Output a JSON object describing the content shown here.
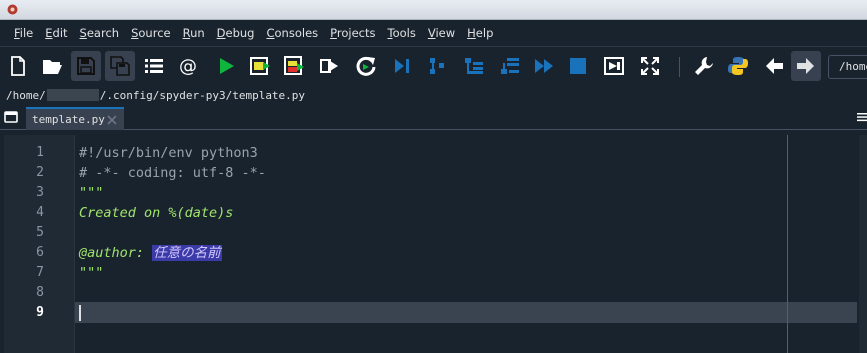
{
  "menu": [
    "File",
    "Edit",
    "Search",
    "Source",
    "Run",
    "Debug",
    "Consoles",
    "Projects",
    "Tools",
    "View",
    "Help"
  ],
  "toolbar": {
    "buttons": [
      "new-file",
      "open-file",
      "save-file",
      "save-all",
      "list",
      "at-symbol",
      "run",
      "run-cell",
      "run-cell-advance",
      "run-selection",
      "rerun",
      "debug-step",
      "debug-continue",
      "debug-step-into",
      "debug-step-return",
      "debug-next",
      "debug-stop",
      "maximize-pane",
      "fullscreen",
      "preferences",
      "python-path",
      "back",
      "forward"
    ],
    "path_value": "/home"
  },
  "filepath": {
    "prefix": "/home/",
    "suffix": "/.config/spyder-py3/template.py"
  },
  "tab": {
    "label": "template.py"
  },
  "editor": {
    "lines": [
      {
        "num": "1",
        "text": "#!/usr/bin/env python3"
      },
      {
        "num": "2",
        "text": "# -*- coding: utf-8 -*-"
      },
      {
        "num": "3",
        "text": "\"\"\""
      },
      {
        "num": "4",
        "text": "Created on %(date)s"
      },
      {
        "num": "5",
        "text": ""
      },
      {
        "num": "6",
        "text": "@author: ",
        "highlight": "任意の名前"
      },
      {
        "num": "7",
        "text": "\"\"\""
      },
      {
        "num": "8",
        "text": ""
      },
      {
        "num": "9",
        "text": ""
      }
    ],
    "current_line": "9"
  },
  "colors": {
    "background": "#19232d",
    "docstring": "#a0e36c",
    "comment": "#9aa3ad",
    "selection": "#3b3ba8",
    "tab_accent": "#1a72bb"
  }
}
